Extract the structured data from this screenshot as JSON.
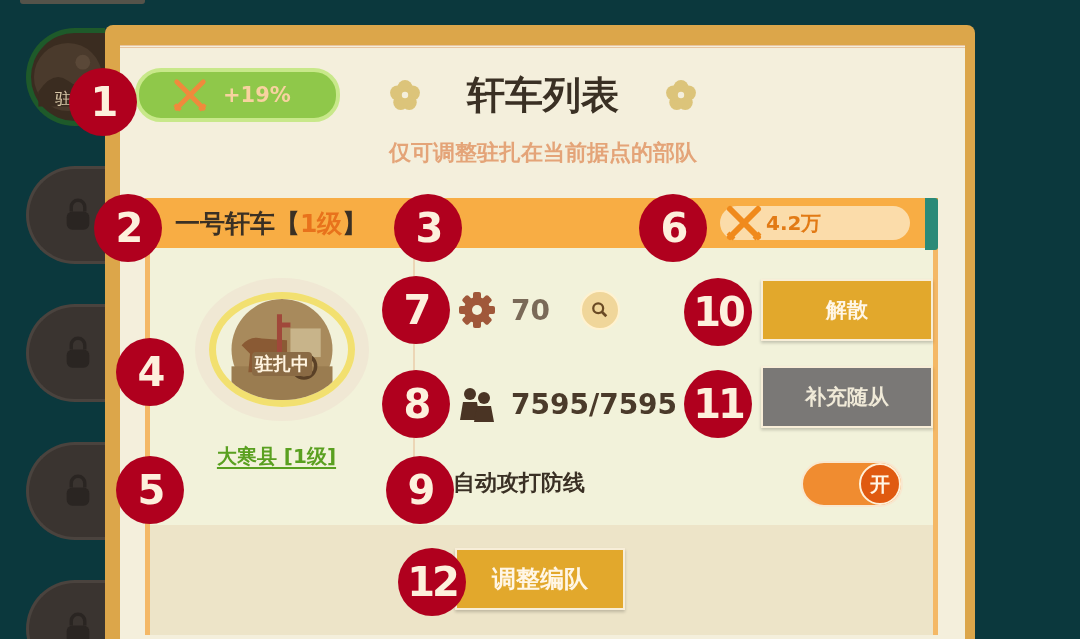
{
  "sidebar": {
    "items": [
      {
        "kind": "active",
        "label": "驻",
        "selected": true
      },
      {
        "kind": "locked",
        "selected": false
      },
      {
        "kind": "locked",
        "selected": false
      },
      {
        "kind": "locked",
        "selected": false
      },
      {
        "kind": "locked",
        "selected": false
      }
    ]
  },
  "panel": {
    "bonus": "+19%",
    "title": "轩车列表",
    "subtitle": "仅可调整驻扎在当前据点的部队"
  },
  "card": {
    "name_open": "一号轩车【",
    "level": "1级",
    "name_close": "】",
    "power": "4.2万",
    "portrait_status": "驻扎中",
    "location": "大寒县 [1级]",
    "stats": [
      {
        "kind": "gear",
        "value": "70",
        "searchable": true
      },
      {
        "kind": "troops",
        "value": "7595/7595"
      }
    ],
    "auto_label": "自动攻打防线",
    "auto_toggle": {
      "on": true,
      "label": "开"
    },
    "buttons": [
      {
        "label": "解散",
        "disabled": false
      },
      {
        "label": "补充随从",
        "disabled": true
      }
    ],
    "footer_button": "调整编队"
  },
  "markers": [
    "1",
    "2",
    "3",
    "4",
    "5",
    "6",
    "7",
    "8",
    "9",
    "10",
    "11",
    "12"
  ]
}
